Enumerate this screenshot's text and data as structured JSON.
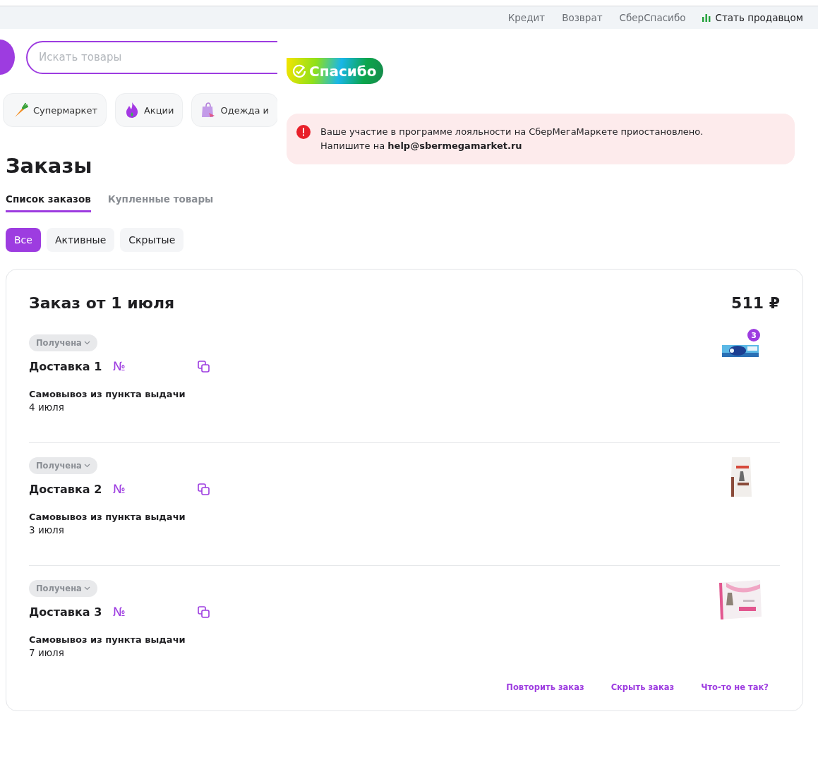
{
  "top_links": [
    {
      "label": "Кредит"
    },
    {
      "label": "Возврат"
    },
    {
      "label": "СберСпасибо"
    }
  ],
  "seller_link": {
    "label": "Стать продавцом"
  },
  "search": {
    "placeholder": "Искать товары"
  },
  "categories": [
    {
      "label": "Супермаркет",
      "kind": "carrot"
    },
    {
      "label": "Акции",
      "kind": "fire"
    },
    {
      "label": "Одежда и",
      "kind": "bag"
    }
  ],
  "loyalty_logo": "Спасибо",
  "alert": {
    "lines": [
      "Ваше участие в программе лояльности на СберМегаМаркете приостановлено.",
      "Напишите на **help@sbermegamarket.ru**"
    ]
  },
  "page_title": "Заказы",
  "tabs": [
    {
      "label": "Список заказов",
      "selected": true
    },
    {
      "label": "Купленные товары",
      "selected": false
    }
  ],
  "filters": [
    {
      "label": "Все",
      "selected": true
    },
    {
      "label": "Активные",
      "selected": false
    },
    {
      "label": "Скрытые",
      "selected": false
    }
  ],
  "order": {
    "title": "Заказ от 1 июля",
    "total": "511 ₽",
    "deliveries": [
      {
        "status": "Получена",
        "title": "Доставка 1",
        "number_label": "№",
        "method": "Самовывоз из пункта выдачи",
        "date": "4 июля",
        "item_count": "3",
        "kind": "picture"
      },
      {
        "status": "Получена",
        "title": "Доставка 2",
        "number_label": "№",
        "method": "Самовывоз из пункта выдачи",
        "date": "3 июля",
        "kind": "picture"
      },
      {
        "status": "Получена",
        "title": "Доставка 3",
        "number_label": "№",
        "method": "Самовывоз из пункта выдачи",
        "date": "7 июля",
        "kind": "picture"
      }
    ],
    "actions": [
      {
        "label": "Повторить заказ"
      },
      {
        "label": "Скрыть заказ"
      },
      {
        "label": "Что-то не так?"
      }
    ]
  }
}
